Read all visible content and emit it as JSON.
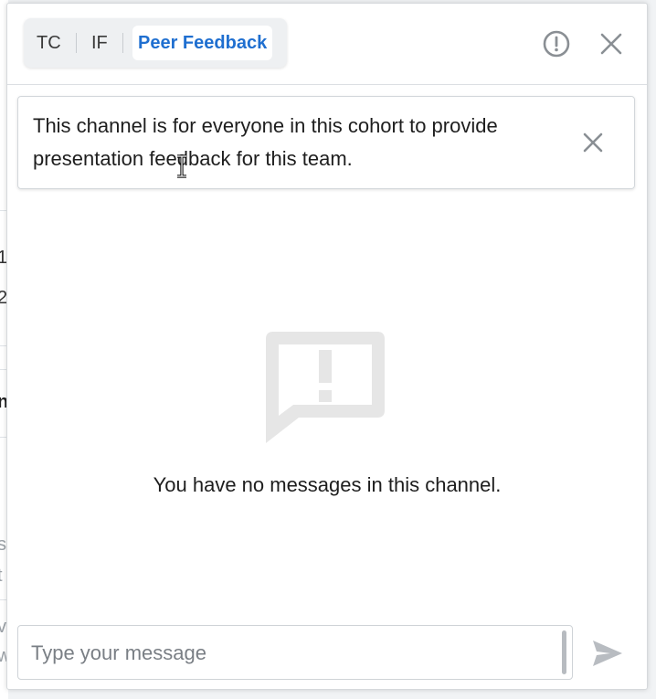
{
  "tabs": [
    {
      "label": "TC",
      "active": false
    },
    {
      "label": "IF",
      "active": false
    },
    {
      "label": "Peer Feedback",
      "active": true
    }
  ],
  "header": {
    "info_icon": "alert-circle-icon",
    "close_icon": "close-icon"
  },
  "notice": {
    "text": "This channel is for everyone in this cohort to provide presentation feedback for this team.",
    "close_icon": "close-icon"
  },
  "empty_state": {
    "icon": "message-alert-icon",
    "text": "You have no messages in this channel."
  },
  "composer": {
    "placeholder": "Type your message",
    "value": "",
    "send_icon": "send-icon"
  },
  "background_fragments": [
    "1",
    "2",
    "n",
    "s",
    "t",
    "v",
    "w"
  ],
  "colors": {
    "accent": "#1f6fd0",
    "icon_gray": "#8a8f94",
    "empty_icon": "#e6e6e6"
  }
}
